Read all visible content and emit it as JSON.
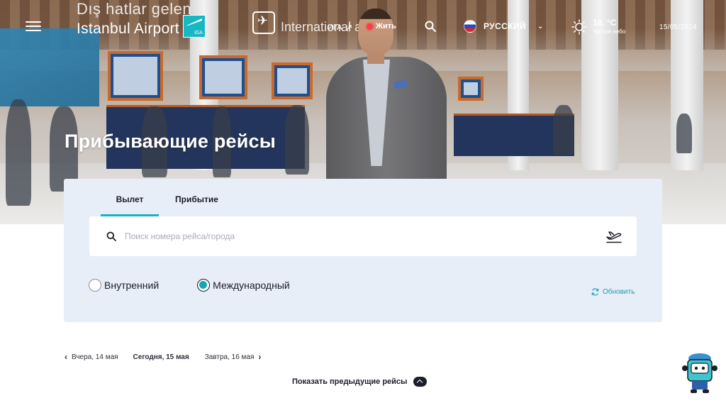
{
  "header": {
    "logo_text": "Istanbul Airport",
    "logo_badge": "iGA",
    "iga_link": "ИГА",
    "live_link": "Жить",
    "language": "РУССКИЙ",
    "weather": {
      "temperature": "18. °C",
      "condition": "Чистое небо"
    },
    "date": "15/05/2024"
  },
  "hero": {
    "title": "Прибывающие рейсы",
    "sign_text": "Dış hatlar gelen",
    "sign_text2": "International a"
  },
  "flight_panel": {
    "tabs": [
      {
        "label": "Вылет",
        "active": true
      },
      {
        "label": "Прибытие",
        "active": false
      }
    ],
    "search_placeholder": "Поиск номера рейса/города",
    "search_value": "",
    "flight_types": [
      {
        "label": "Внутренний",
        "selected": false
      },
      {
        "label": "Международный",
        "selected": true
      }
    ],
    "refresh_label": "Обновить"
  },
  "day_nav": {
    "prev": "Вчера, 14 мая",
    "today": "Сегодня, 15 мая",
    "next": "Завтра, 16 мая"
  },
  "show_previous": "Показать предыдущие рейсы",
  "colors": {
    "accent": "#18b3c3",
    "panel_bg": "#e7eef7",
    "text_dark": "#1b1d29",
    "live_red": "#ff3b45"
  },
  "icons": [
    "menu-icon",
    "search-icon",
    "russia-flag-icon",
    "chevron-down-icon",
    "sun-icon",
    "plane-departure-icon",
    "refresh-icon",
    "chevron-left-icon",
    "chevron-right-icon",
    "chevron-up-icon",
    "assistant-robot-icon",
    "external-link-icon"
  ]
}
